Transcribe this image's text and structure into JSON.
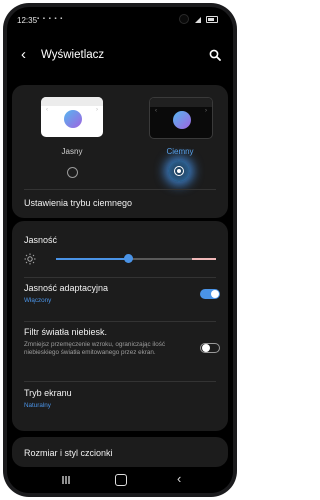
{
  "status_bar": {
    "time": "12:35",
    "icons": "▪ ▪ ▪ ▪ ▪"
  },
  "header": {
    "title": "Wyświetlacz",
    "back_icon": "back-arrow-icon",
    "search_icon": "search-icon"
  },
  "theme": {
    "light_label": "Jasny",
    "dark_label": "Ciemny",
    "selected": "dark",
    "accent_color": "#4a93e6",
    "dark_mode_settings_label": "Ustawienia trybu ciemnego"
  },
  "brightness": {
    "label": "Jasność",
    "level": 0.45
  },
  "adaptive_brightness": {
    "label": "Jasność adaptacyjna",
    "status": "Włączony",
    "enabled": true
  },
  "blue_light": {
    "label": "Filtr światła niebiesk.",
    "description": "Zmniejsz przemęczenie wzroku, ograniczając ilość niebieskiego światła emitowanego przez ekran.",
    "enabled": false
  },
  "screen_mode": {
    "label": "Tryb ekranu",
    "value": "Naturalny"
  },
  "font": {
    "label": "Rozmiar i styl czcionki"
  },
  "nav": {
    "recent_icon": "recent-apps-icon",
    "home_icon": "home-icon",
    "back_icon": "back-nav-icon"
  }
}
